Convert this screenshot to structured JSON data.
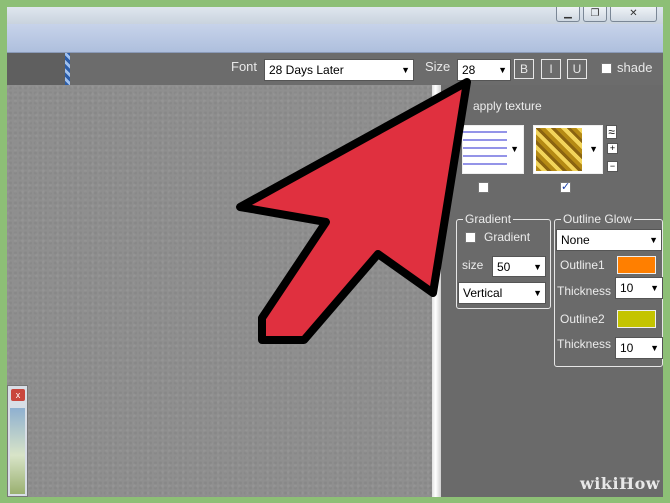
{
  "toolbar": {
    "font_label": "Font",
    "font_value": "28 Days Later",
    "size_label": "Size",
    "size_value": "28",
    "bold_label": "B",
    "italic_label": "I",
    "underline_label": "U",
    "shade_label": "shade"
  },
  "texture": {
    "apply_label": "apply texture",
    "plus_label": "+",
    "minus_label": "−",
    "wave_label": "≈",
    "check_mark": "✓"
  },
  "gradient": {
    "title": "Gradient",
    "checkbox_label": "Gradient",
    "size_label": "size",
    "size_value": "50",
    "direction_value": "Vertical"
  },
  "outline_glow": {
    "title": "Outline Glow",
    "mode_value": "None",
    "outline1_label": "Outline1",
    "outline1_color": "#ff7f00",
    "thickness1_label": "Thickness",
    "thickness1_value": "10",
    "outline2_label": "Outline2",
    "outline2_color": "#c4c400",
    "thickness2_label": "Thickness",
    "thickness2_value": "10"
  },
  "subwindow": {
    "close_label": "x"
  },
  "watermark": {
    "text_a": "wiki",
    "text_b": "How"
  },
  "colors": {
    "arrow_fill": "#e0303f",
    "arrow_stroke": "#000000"
  }
}
